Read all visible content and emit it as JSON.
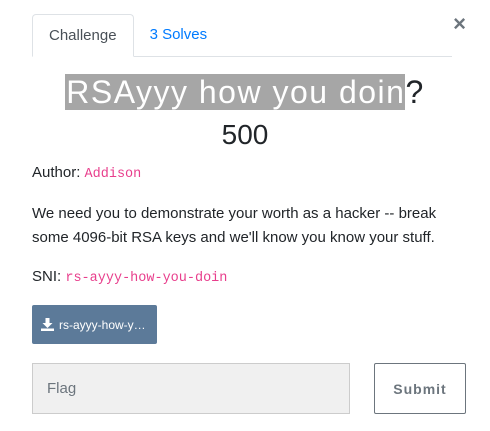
{
  "tabs": [
    {
      "label": "Challenge",
      "active": true
    },
    {
      "label": "3 Solves",
      "active": false
    }
  ],
  "close_label": "×",
  "challenge": {
    "title_highlighted": "RSAyyy how you doin",
    "title_rest": "?",
    "value": "500",
    "author_label": "Author:",
    "author": "Addison",
    "description": "We need you to demonstrate your worth as a hacker -- break some 4096-bit RSA keys and we'll know you know your stuff.",
    "sni_label": "SNI:",
    "sni": "rs-ayyy-how-you-doin"
  },
  "download": {
    "icon": "download-icon",
    "label": "rs-ayyy-how-you-doin"
  },
  "flag": {
    "placeholder": "Flag",
    "value": ""
  },
  "submit_label": "Submit",
  "colors": {
    "link": "#007bff",
    "code": "#e83e8c",
    "download_bg": "#5c7a99",
    "title_highlight": "#a6a6a6"
  }
}
